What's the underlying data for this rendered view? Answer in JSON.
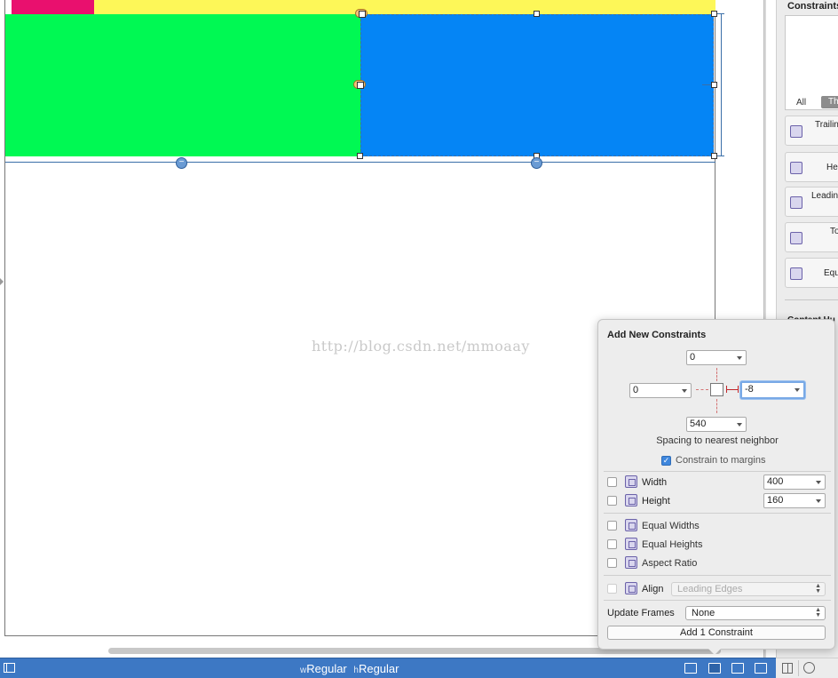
{
  "canvas": {
    "watermark": "http://blog.csdn.net/mmoaay",
    "colors": {
      "pink": "#e9106e",
      "yellow": "#fdf758",
      "green": "#00f953",
      "blue": "#0585f5"
    }
  },
  "inspector": {
    "title": "Constraints",
    "seg_all": "All",
    "seg_this": "Th",
    "items": [
      {
        "label": "Trailin"
      },
      {
        "label": "He"
      },
      {
        "label": "Leadin"
      },
      {
        "label": "To"
      },
      {
        "label": "Equ"
      }
    ],
    "content_heading": "Content Hu"
  },
  "popover": {
    "title": "Add New Constraints",
    "top_value": "0",
    "left_value": "0",
    "right_value": "-8",
    "bottom_value": "540",
    "spacing_label": "Spacing to nearest neighbor",
    "constrain_margins": {
      "label": "Constrain to margins",
      "checked": true
    },
    "width": {
      "label": "Width",
      "value": "400",
      "checked": false
    },
    "height": {
      "label": "Height",
      "value": "160",
      "checked": false
    },
    "equal_widths": {
      "label": "Equal Widths",
      "checked": false
    },
    "equal_heights": {
      "label": "Equal Heights",
      "checked": false
    },
    "aspect_ratio": {
      "label": "Aspect Ratio",
      "checked": false
    },
    "align": {
      "label": "Align",
      "value": "Leading Edges",
      "checked": false
    },
    "update_frames": {
      "label": "Update Frames",
      "value": "None"
    },
    "add_button": "Add 1 Constraint"
  },
  "bottombar": {
    "w_prefix": "w",
    "w_value": "Regular",
    "h_prefix": "h",
    "h_value": "Regular",
    "icons": [
      "stack-icon",
      "pin-icon",
      "align-icon",
      "resolve-icon"
    ]
  }
}
